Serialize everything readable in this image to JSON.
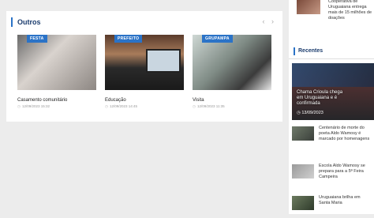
{
  "left_section": {
    "heading": "Outros",
    "arrows": "‹ ›",
    "cards": [
      {
        "tag": "FESTA",
        "title": "Casamento comunitário",
        "date": "12/09/2023 15:32"
      },
      {
        "tag": "PREFEITO",
        "title": "Educação",
        "date": "12/09/2023 14:45"
      },
      {
        "tag": "GRUPAMPA",
        "title": "Visita",
        "date": "12/09/2023 11:35"
      }
    ]
  },
  "right_section": {
    "top_item": {
      "text": "Cooperativa de Uruguaiana entrega mais de 15 milhões de doações"
    },
    "heading": "Recentes",
    "featured": {
      "title": "Chama Crioula chega em Uruguaiana e é confirmada",
      "date": "13/09/2023"
    },
    "items": [
      {
        "text": "Centenário de morte do poeta Aldo Wamosy é marcado por homenagens"
      },
      {
        "text": "Escola Aldo Wamosy se prepara para a 5ª Feira Campeira"
      },
      {
        "text": "Uruguaiana brilha em Santa Maria"
      }
    ]
  },
  "colors": {
    "accent": "#2b73c7",
    "heading": "#1c3d6e"
  }
}
